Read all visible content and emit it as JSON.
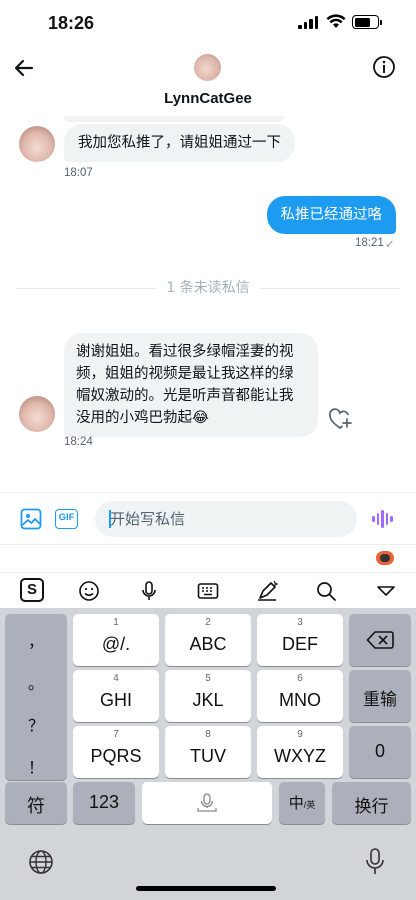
{
  "status": {
    "time": "18:26"
  },
  "header": {
    "name": "LynnCatGee"
  },
  "messages": [
    {
      "text": "我加您私推了，请姐姐通过一下",
      "time": "18:07",
      "direction": "in"
    },
    {
      "text": "私推已经通过咯",
      "time": "18:21",
      "direction": "out",
      "read_mark": "✓"
    },
    {
      "text_lines": [
        "谢谢姐姐。看过很多绿帽淫妻的视",
        "频，姐姐的视频是最让我这样的绿",
        "帽奴激动的。光是听声音都能让我",
        "没用的小鸡巴勃起😂"
      ],
      "time": "18:24",
      "direction": "in"
    }
  ],
  "unread_divider": "1 条未读私信",
  "composer": {
    "placeholder": "开始写私信",
    "gif_label": "GIF"
  },
  "keyboard": {
    "logo": "S",
    "punctuation": [
      "，",
      "。",
      "？",
      "！"
    ],
    "keys": [
      {
        "num": "1",
        "label": "@/."
      },
      {
        "num": "2",
        "label": "ABC"
      },
      {
        "num": "3",
        "label": "DEF"
      },
      {
        "num": "4",
        "label": "GHI"
      },
      {
        "num": "5",
        "label": "JKL"
      },
      {
        "num": "6",
        "label": "MNO"
      },
      {
        "num": "7",
        "label": "PQRS"
      },
      {
        "num": "8",
        "label": "TUV"
      },
      {
        "num": "9",
        "label": "WXYZ"
      }
    ],
    "reenter": "重输",
    "zero": "0",
    "symbol": "符",
    "num123": "123",
    "lang_main": "中",
    "lang_sub": "/英",
    "newline": "换行"
  },
  "colors": {
    "accent": "#1d9bf0",
    "bubble_in": "#eff3f4",
    "keyboard_bg": "#d1d4d9"
  }
}
